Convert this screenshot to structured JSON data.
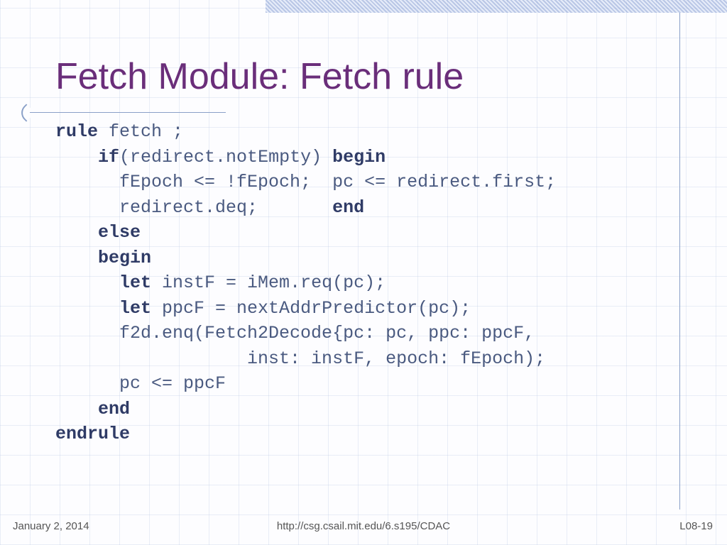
{
  "title": "Fetch Module: Fetch rule",
  "code": {
    "l1": {
      "kw": "rule",
      "rest": " fetch ;"
    },
    "l2": {
      "pre": "    ",
      "kw1": "if",
      "mid": "(redirect.notEmpty) ",
      "kw2": "begin"
    },
    "l3": "      fEpoch <= !fEpoch;  pc <= redirect.first;",
    "l4": {
      "pre": "      redirect.deq;       ",
      "kw": "end"
    },
    "l5": {
      "pre": "    ",
      "kw": "else"
    },
    "l6": {
      "pre": "    ",
      "kw": "begin"
    },
    "l7": {
      "pre": "      ",
      "kw": "let",
      "rest": " instF = iMem.req(pc);"
    },
    "l8": {
      "pre": "      ",
      "kw": "let",
      "rest": " ppcF = nextAddrPredictor(pc);"
    },
    "l9": "      f2d.enq(Fetch2Decode{pc: pc, ppc: ppcF,",
    "l10": "                  inst: instF, epoch: fEpoch);",
    "l11": "      pc <= ppcF",
    "l12": {
      "pre": "    ",
      "kw": "end"
    },
    "l13": {
      "kw": "endrule"
    }
  },
  "footer": {
    "date": "January 2, 2014",
    "url": "http://csg.csail.mit.edu/6.s195/CDAC",
    "page": "L08-19"
  }
}
